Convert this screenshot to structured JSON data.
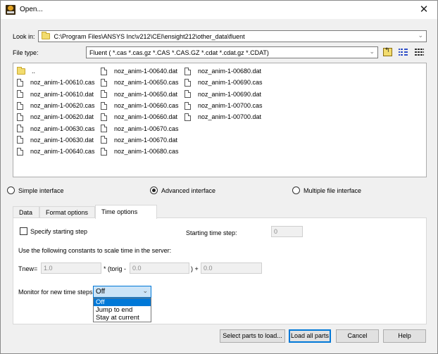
{
  "window": {
    "title": "Open...",
    "close_label": "✕"
  },
  "look_in": {
    "label": "Look in:",
    "value": "C:\\Program Files\\ANSYS Inc\\v212\\CEI\\ensight212\\other_data\\fluent"
  },
  "file_type": {
    "label": "File type:",
    "value": "Fluent ( *.cas *.cas.gz *.CAS *.CAS.GZ *.cdat *.cdat.gz *.CDAT)"
  },
  "toolbar": {
    "up_folder": "up-folder-icon",
    "list_view": "list-view-icon",
    "detail_view": "detail-view-icon"
  },
  "files": {
    "col1": [
      {
        "name": "..",
        "type": "folder"
      },
      {
        "name": "noz_anim-1-00610.cas",
        "type": "file"
      },
      {
        "name": "noz_anim-1-00610.dat",
        "type": "file"
      },
      {
        "name": "noz_anim-1-00620.cas",
        "type": "file"
      },
      {
        "name": "noz_anim-1-00620.dat",
        "type": "file"
      },
      {
        "name": "noz_anim-1-00630.cas",
        "type": "file"
      },
      {
        "name": "noz_anim-1-00630.dat",
        "type": "file"
      },
      {
        "name": "noz_anim-1-00640.cas",
        "type": "file"
      }
    ],
    "col2": [
      {
        "name": "noz_anim-1-00640.dat",
        "type": "file"
      },
      {
        "name": "noz_anim-1-00650.cas",
        "type": "file"
      },
      {
        "name": "noz_anim-1-00650.dat",
        "type": "file"
      },
      {
        "name": "noz_anim-1-00660.cas",
        "type": "file"
      },
      {
        "name": "noz_anim-1-00660.dat",
        "type": "file"
      },
      {
        "name": "noz_anim-1-00670.cas",
        "type": "file"
      },
      {
        "name": "noz_anim-1-00670.dat",
        "type": "file"
      },
      {
        "name": "noz_anim-1-00680.cas",
        "type": "file"
      }
    ],
    "col3": [
      {
        "name": "noz_anim-1-00680.dat",
        "type": "file"
      },
      {
        "name": "noz_anim-1-00690.cas",
        "type": "file"
      },
      {
        "name": "noz_anim-1-00690.dat",
        "type": "file"
      },
      {
        "name": "noz_anim-1-00700.cas",
        "type": "file"
      },
      {
        "name": "noz_anim-1-00700.dat",
        "type": "file"
      }
    ]
  },
  "interface": {
    "options": [
      {
        "label": "Simple interface",
        "selected": false
      },
      {
        "label": "Advanced interface",
        "selected": true
      },
      {
        "label": "Multiple file interface",
        "selected": false
      }
    ]
  },
  "tabs": [
    {
      "label": "Data",
      "active": false
    },
    {
      "label": "Format options",
      "active": false
    },
    {
      "label": "Time options",
      "active": true
    }
  ],
  "time_options": {
    "specify_starting_step_label": "Specify starting step",
    "specify_starting_step_checked": false,
    "starting_time_step_label": "Starting time step:",
    "starting_time_step_value": "0",
    "scale_text": "Use the following constants to scale time in the server:",
    "tnew_label": "Tnew=",
    "tnew_value": "1.0",
    "torig_label": "* (torig -",
    "torig_value": "0.0",
    "plus_label": ") +",
    "plus_value": "0.0",
    "monitor_label": "Monitor for new time steps",
    "monitor_value": "Off",
    "monitor_options": [
      "Off",
      "Jump to end",
      "Stay at current"
    ],
    "monitor_selected_index": 0
  },
  "buttons": {
    "select_parts": "Select parts to load...",
    "load_all": "Load all parts",
    "cancel": "Cancel",
    "help": "Help"
  }
}
